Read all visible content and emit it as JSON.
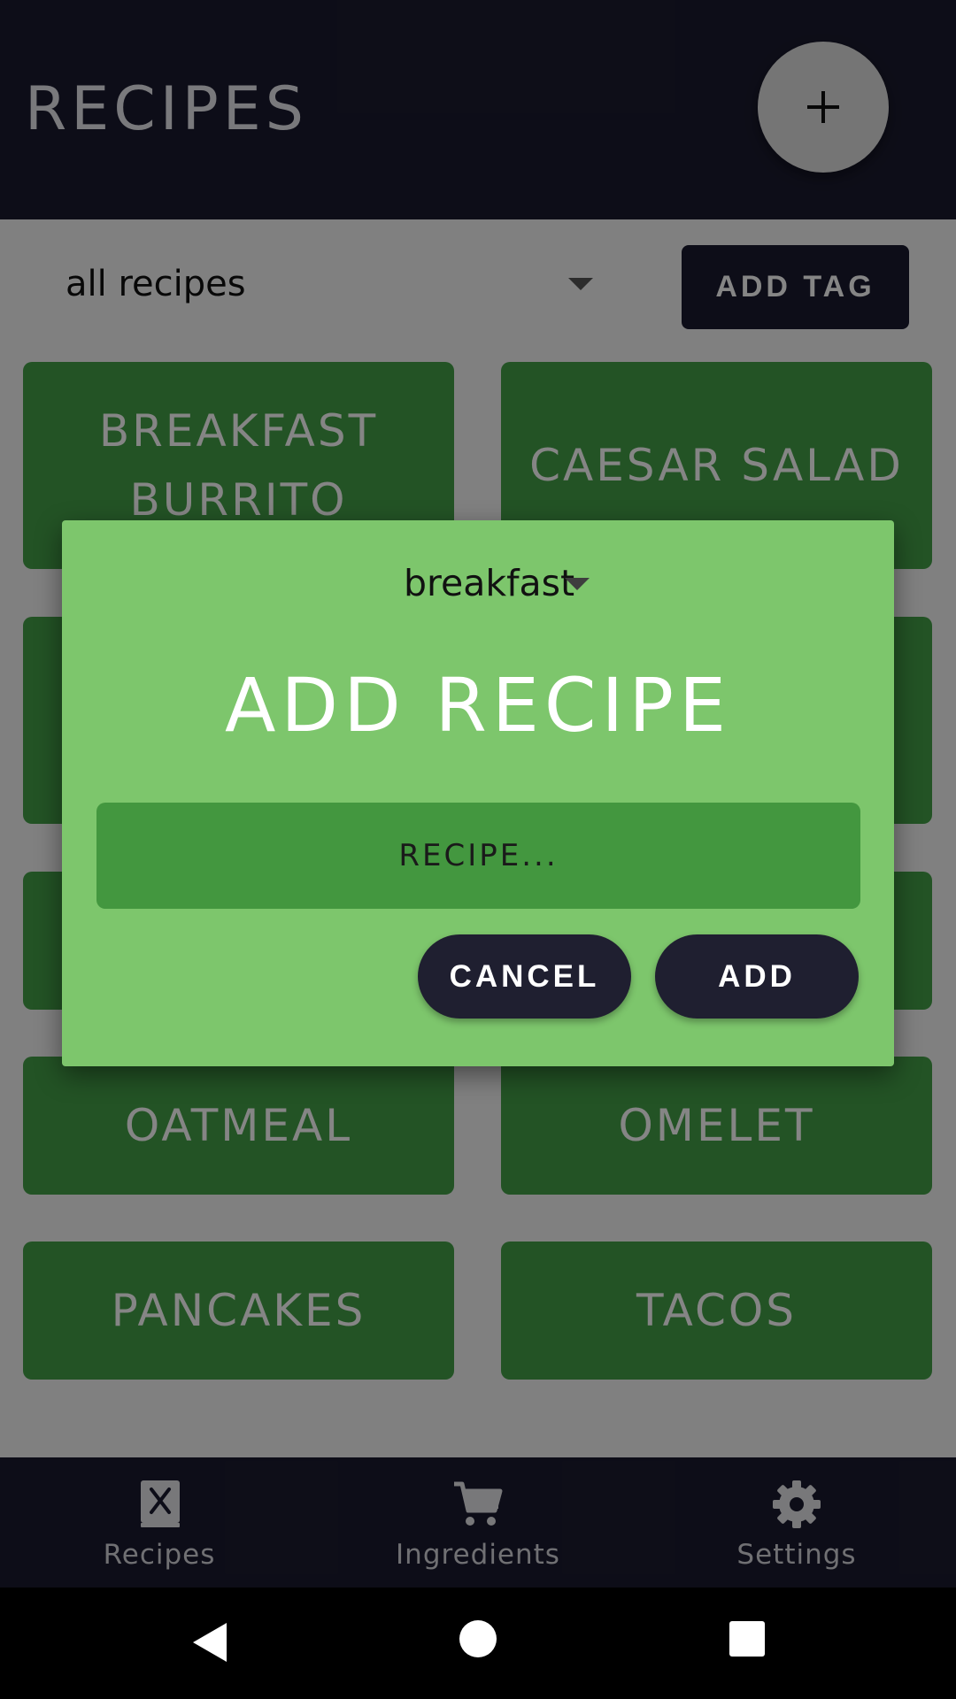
{
  "header": {
    "title": "RECIPES",
    "fab_icon": "plus-icon"
  },
  "filter": {
    "selected_tag": "all recipes",
    "add_tag_label": "ADD TAG"
  },
  "recipes": [
    {
      "name": "BREAKFAST BURRITO"
    },
    {
      "name": "CAESAR SALAD"
    },
    {
      "name": ""
    },
    {
      "name": ""
    },
    {
      "name": ""
    },
    {
      "name": ""
    },
    {
      "name": "OATMEAL"
    },
    {
      "name": "OMELET"
    },
    {
      "name": "PANCAKES"
    },
    {
      "name": "TACOS"
    }
  ],
  "dialog": {
    "selected_tag": "breakfast",
    "title": "ADD RECIPE",
    "input_placeholder": "RECIPE...",
    "input_value": "",
    "cancel_label": "CANCEL",
    "add_label": "ADD"
  },
  "bottom_nav": {
    "items": [
      {
        "label": "Recipes",
        "icon": "recipe-book-icon"
      },
      {
        "label": "Ingredients",
        "icon": "cart-icon"
      },
      {
        "label": "Settings",
        "icon": "gear-icon"
      }
    ]
  },
  "system_nav": {
    "icons": [
      "back-icon",
      "home-icon",
      "recents-icon"
    ]
  },
  "colors": {
    "header_bg": "#1a1a2e",
    "card_green": "#43a047",
    "dialog_green": "#7dc66c",
    "input_green": "#43973f"
  }
}
